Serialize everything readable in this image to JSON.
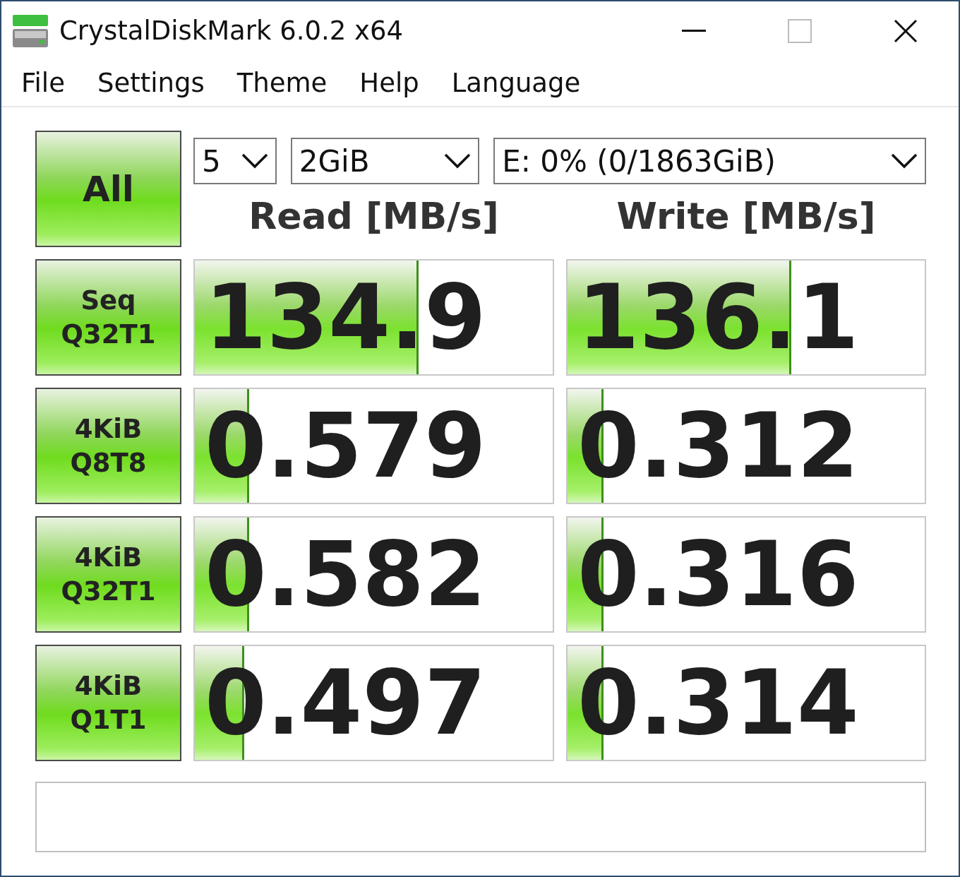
{
  "window": {
    "title": "CrystalDiskMark 6.0.2 x64"
  },
  "menu": [
    "File",
    "Settings",
    "Theme",
    "Help",
    "Language"
  ],
  "all_button": "All",
  "selectors": [
    {
      "value": "5"
    },
    {
      "value": "2GiB"
    },
    {
      "value": "E: 0% (0/1863GiB)"
    }
  ],
  "columns": [
    "Read [MB/s]",
    "Write [MB/s]"
  ],
  "tests": [
    {
      "label": "Seq\nQ32T1",
      "read": {
        "value": "134.9",
        "level": 0.62
      },
      "write": {
        "value": "136.1",
        "level": 0.62
      }
    },
    {
      "label": "4KiB\nQ8T8",
      "read": {
        "value": "0.579",
        "level": 0.145
      },
      "write": {
        "value": "0.312",
        "level": 0.094
      }
    },
    {
      "label": "4KiB\nQ32T1",
      "read": {
        "value": "0.582",
        "level": 0.145
      },
      "write": {
        "value": "0.316",
        "level": 0.094
      }
    },
    {
      "label": "4KiB\nQ1T1",
      "read": {
        "value": "0.497",
        "level": 0.133
      },
      "write": {
        "value": "0.314",
        "level": 0.094
      }
    }
  ]
}
